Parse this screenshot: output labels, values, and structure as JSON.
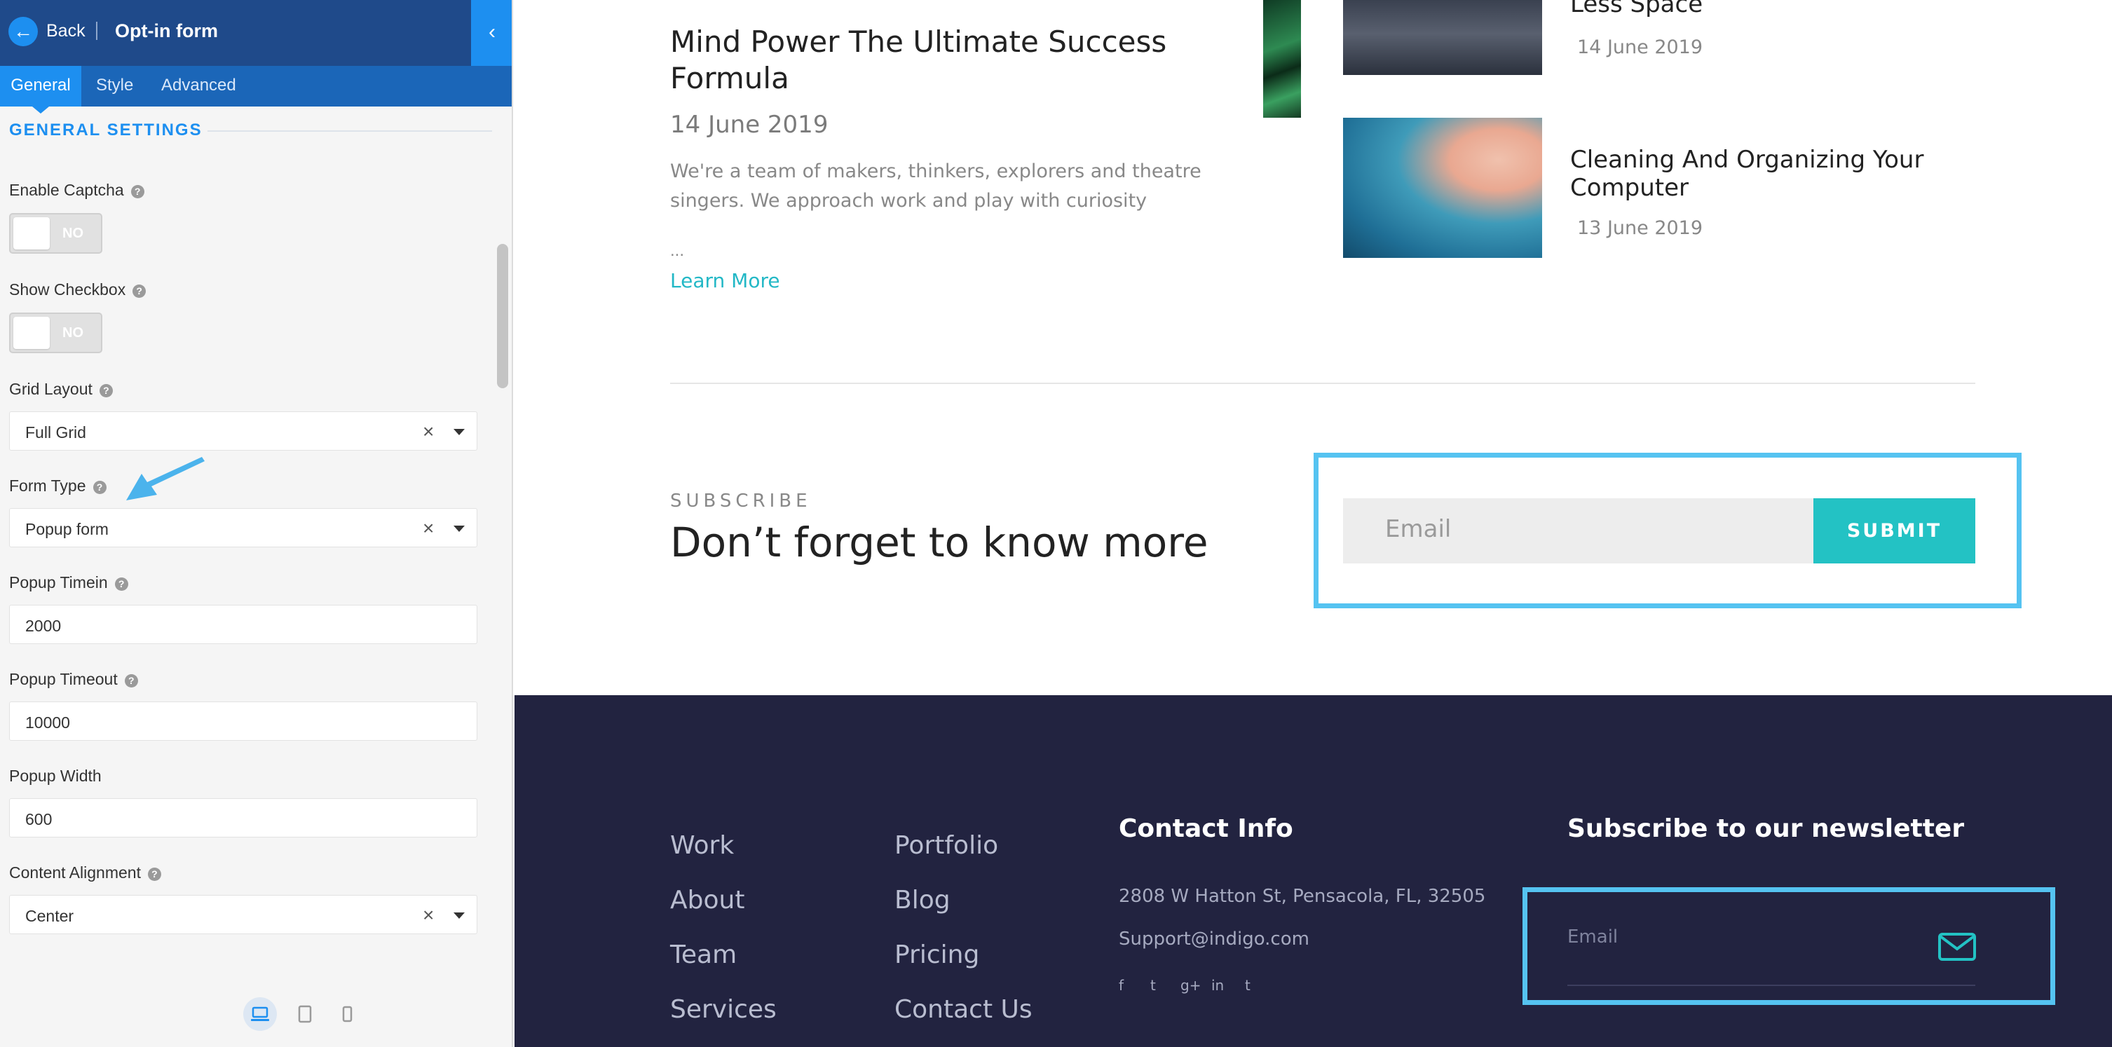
{
  "sidebar": {
    "back_label": "Back",
    "header_separator": "|",
    "title": "Opt-in form",
    "collapse_glyph": "‹",
    "tabs": [
      {
        "label": "General",
        "active": true
      },
      {
        "label": "Style",
        "active": false
      },
      {
        "label": "Advanced",
        "active": false
      }
    ],
    "section_heading": "GENERAL SETTINGS",
    "help_glyph": "?",
    "clear_glyph": "×",
    "fields": {
      "enable_captcha": {
        "label": "Enable Captcha",
        "value": "NO"
      },
      "show_checkbox": {
        "label": "Show Checkbox",
        "value": "NO"
      },
      "grid_layout": {
        "label": "Grid Layout",
        "value": "Full Grid"
      },
      "form_type": {
        "label": "Form Type",
        "value": "Popup form"
      },
      "popup_timein": {
        "label": "Popup Timein",
        "value": "2000"
      },
      "popup_timeout": {
        "label": "Popup Timeout",
        "value": "10000"
      },
      "popup_width": {
        "label": "Popup Width",
        "value": "600"
      },
      "content_alignment": {
        "label": "Content Alignment",
        "value": "Center"
      }
    },
    "device_icons": [
      "desktop-icon",
      "tablet-icon",
      "mobile-icon"
    ]
  },
  "blog": {
    "post1": {
      "title": "Mind Power The Ultimate Success Formula",
      "date": "14 June 2019",
      "excerpt": "We're a team of makers, thinkers, explorers and theatre singers. We approach work and play with curiosity",
      "ellipsis": "...",
      "link": "Learn More"
    },
    "post2": {
      "title": "Less Space",
      "date": "14 June 2019"
    },
    "post3": {
      "title": "Cleaning And Organizing Your Computer",
      "date": "13 June 2019"
    }
  },
  "subscribe": {
    "eyebrow": "SUBSCRIBE",
    "heading": "Don’t forget to know more",
    "email_placeholder": "Email",
    "submit_label": "SUBMIT"
  },
  "footer": {
    "links_col1": [
      "Work",
      "About",
      "Team",
      "Services"
    ],
    "links_col2": [
      "Portfolio",
      "Blog",
      "Pricing",
      "Contact Us"
    ],
    "contact": {
      "title": "Contact Info",
      "address": "2808 W Hatton St, Pensacola, FL, 32505",
      "email": "Support@indigo.com",
      "social": [
        "f",
        "t",
        "g+",
        "in",
        "t"
      ]
    },
    "newsletter": {
      "title": "Subscribe to our newsletter",
      "email_placeholder": "Email"
    }
  },
  "colors": {
    "sidebar_header": "#1f4a8a",
    "accent_blue": "#1d8ff0",
    "teal": "#23c2c4",
    "highlight": "#55c3f1",
    "footer_bg": "#222340"
  }
}
